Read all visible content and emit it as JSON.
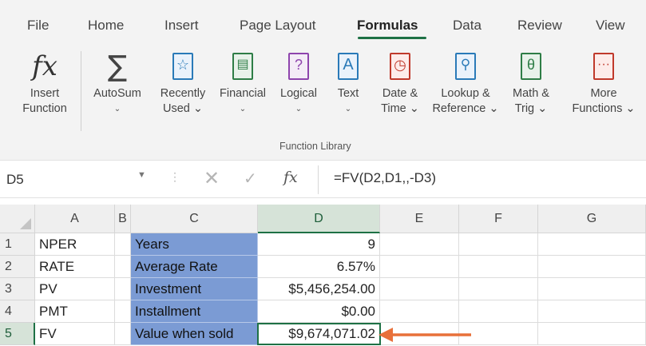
{
  "ribbon": {
    "tabs": [
      "File",
      "Home",
      "Insert",
      "Page Layout",
      "Formulas",
      "Data",
      "Review",
      "View"
    ],
    "active_tab": "Formulas",
    "buttons": {
      "insert_function": {
        "line1": "Insert",
        "line2": "Function",
        "icon": "fx-icon"
      },
      "autosum": {
        "line1": "AutoSum",
        "chevron": "⌄",
        "icon": "sigma-icon"
      },
      "recently_used": {
        "line1": "Recently",
        "line2": "Used ⌄",
        "icon": "star-book-icon"
      },
      "financial": {
        "line1": "Financial",
        "chevron": "⌄",
        "icon": "database-book-icon"
      },
      "logical": {
        "line1": "Logical",
        "chevron": "⌄",
        "icon": "question-book-icon"
      },
      "text": {
        "line1": "Text",
        "chevron": "⌄",
        "icon": "text-a-book-icon"
      },
      "date_time": {
        "line1": "Date &",
        "line2": "Time ⌄",
        "icon": "clock-book-icon"
      },
      "lookup": {
        "line1": "Lookup &",
        "line2": "Reference ⌄",
        "icon": "search-book-icon"
      },
      "math_trig": {
        "line1": "Math &",
        "line2": "Trig ⌄",
        "icon": "theta-book-icon"
      },
      "more_functions": {
        "line1": "More",
        "line2": "Functions ⌄",
        "icon": "dots-book-icon"
      }
    },
    "group_label": "Function Library",
    "accent_color": "#1e7145"
  },
  "formula_bar": {
    "name_box": "D5",
    "fx_label": "fx",
    "formula": "=FV(D2,D1,,-D3)"
  },
  "grid": {
    "columns": [
      "A",
      "B",
      "C",
      "D",
      "E",
      "F",
      "G"
    ],
    "selected_column": "D",
    "rows": [
      {
        "num": "1",
        "A": "NPER",
        "C": "Years",
        "D": "9"
      },
      {
        "num": "2",
        "A": "RATE",
        "C": "Average Rate",
        "D": "6.57%"
      },
      {
        "num": "3",
        "A": "PV",
        "C": "Investment",
        "D": "$5,456,254.00"
      },
      {
        "num": "4",
        "A": "PMT",
        "C": "Installment",
        "D": "$0.00"
      },
      {
        "num": "5",
        "A": "FV",
        "C": "Value when sold",
        "D": "$9,674,071.02"
      }
    ],
    "selected_row": "5",
    "label_fill_color": "#7b9bd4",
    "arrow_color": "#e8703a"
  }
}
